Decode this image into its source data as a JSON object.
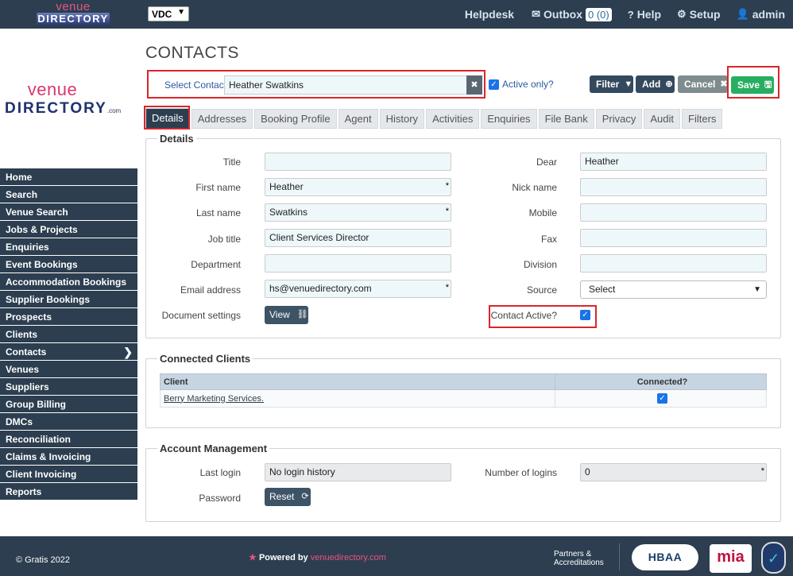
{
  "topbar": {
    "logo_line1": "venue",
    "logo_line2": "DIRECTORY",
    "instance": "VDC",
    "helpdesk": "Helpdesk",
    "outbox": "Outbox",
    "outbox_count": "0 (0)",
    "help": "Help",
    "setup": "Setup",
    "user": "admin"
  },
  "sidebar": {
    "logo_line1": "venue",
    "logo_line2": "DIRECTORY",
    "logo_suffix": ".com",
    "items": [
      {
        "label": "Home"
      },
      {
        "label": "Search"
      },
      {
        "label": "Venue Search"
      },
      {
        "label": "Jobs & Projects"
      },
      {
        "label": "Enquiries"
      },
      {
        "label": "Event Bookings"
      },
      {
        "label": "Accommodation Bookings"
      },
      {
        "label": "Supplier Bookings"
      },
      {
        "label": "Prospects"
      },
      {
        "label": "Clients"
      },
      {
        "label": "Contacts"
      },
      {
        "label": "Venues"
      },
      {
        "label": "Suppliers"
      },
      {
        "label": "Group Billing"
      },
      {
        "label": "DMCs"
      },
      {
        "label": "Reconciliation"
      },
      {
        "label": "Claims & Invoicing"
      },
      {
        "label": "Client Invoicing"
      },
      {
        "label": "Reports"
      }
    ],
    "active_index": 10
  },
  "page": {
    "title": "CONTACTS",
    "select_contact_label": "Select Contact",
    "select_contact_value": "Heather Swatkins",
    "active_only_label": "Active only?",
    "filter_label": "Filter",
    "add_label": "Add",
    "cancel_label": "Cancel",
    "save_label": "Save"
  },
  "tabs": [
    "Details",
    "Addresses",
    "Booking Profile",
    "Agent",
    "History",
    "Activities",
    "Enquiries",
    "File Bank",
    "Privacy",
    "Audit",
    "Filters"
  ],
  "details": {
    "legend": "Details",
    "title_label": "Title",
    "title_value": "",
    "first_name_label": "First name",
    "first_name_value": "Heather",
    "last_name_label": "Last name",
    "last_name_value": "Swatkins",
    "job_title_label": "Job title",
    "job_title_value": "Client Services Director",
    "department_label": "Department",
    "department_value": "",
    "email_label": "Email address",
    "email_value": "hs@venuedirectory.com",
    "document_settings_label": "Document settings",
    "view_label": "View",
    "dear_label": "Dear",
    "dear_value": "Heather",
    "nick_name_label": "Nick name",
    "nick_name_value": "",
    "mobile_label": "Mobile",
    "mobile_value": "",
    "fax_label": "Fax",
    "fax_value": "",
    "division_label": "Division",
    "division_value": "",
    "source_label": "Source",
    "source_value": "Select",
    "contact_active_label": "Contact Active?",
    "required_mark": "*"
  },
  "connected_clients": {
    "legend": "Connected Clients",
    "col_client": "Client",
    "col_connected": "Connected?",
    "rows": [
      {
        "client": "Berry Marketing Services."
      }
    ]
  },
  "account": {
    "legend": "Account Management",
    "last_login_label": "Last login",
    "last_login_value": "No login history",
    "logins_label": "Number of logins",
    "logins_value": "0",
    "password_label": "Password",
    "reset_label": "Reset"
  },
  "footer": {
    "copyright": "© Gratis 2022",
    "powered_by": "Powered by",
    "powered_brand": "venuedirectory.com",
    "partners_line1": "Partners &",
    "partners_line2": "Accreditations",
    "hbaa": "HBAA",
    "mia": "mia"
  },
  "colors": {
    "navy": "#2c3e50",
    "save_green": "#27ae60",
    "highlight_red": "#d9262b",
    "input_bg": "#eef8fb",
    "brand_pink": "#e75480"
  }
}
